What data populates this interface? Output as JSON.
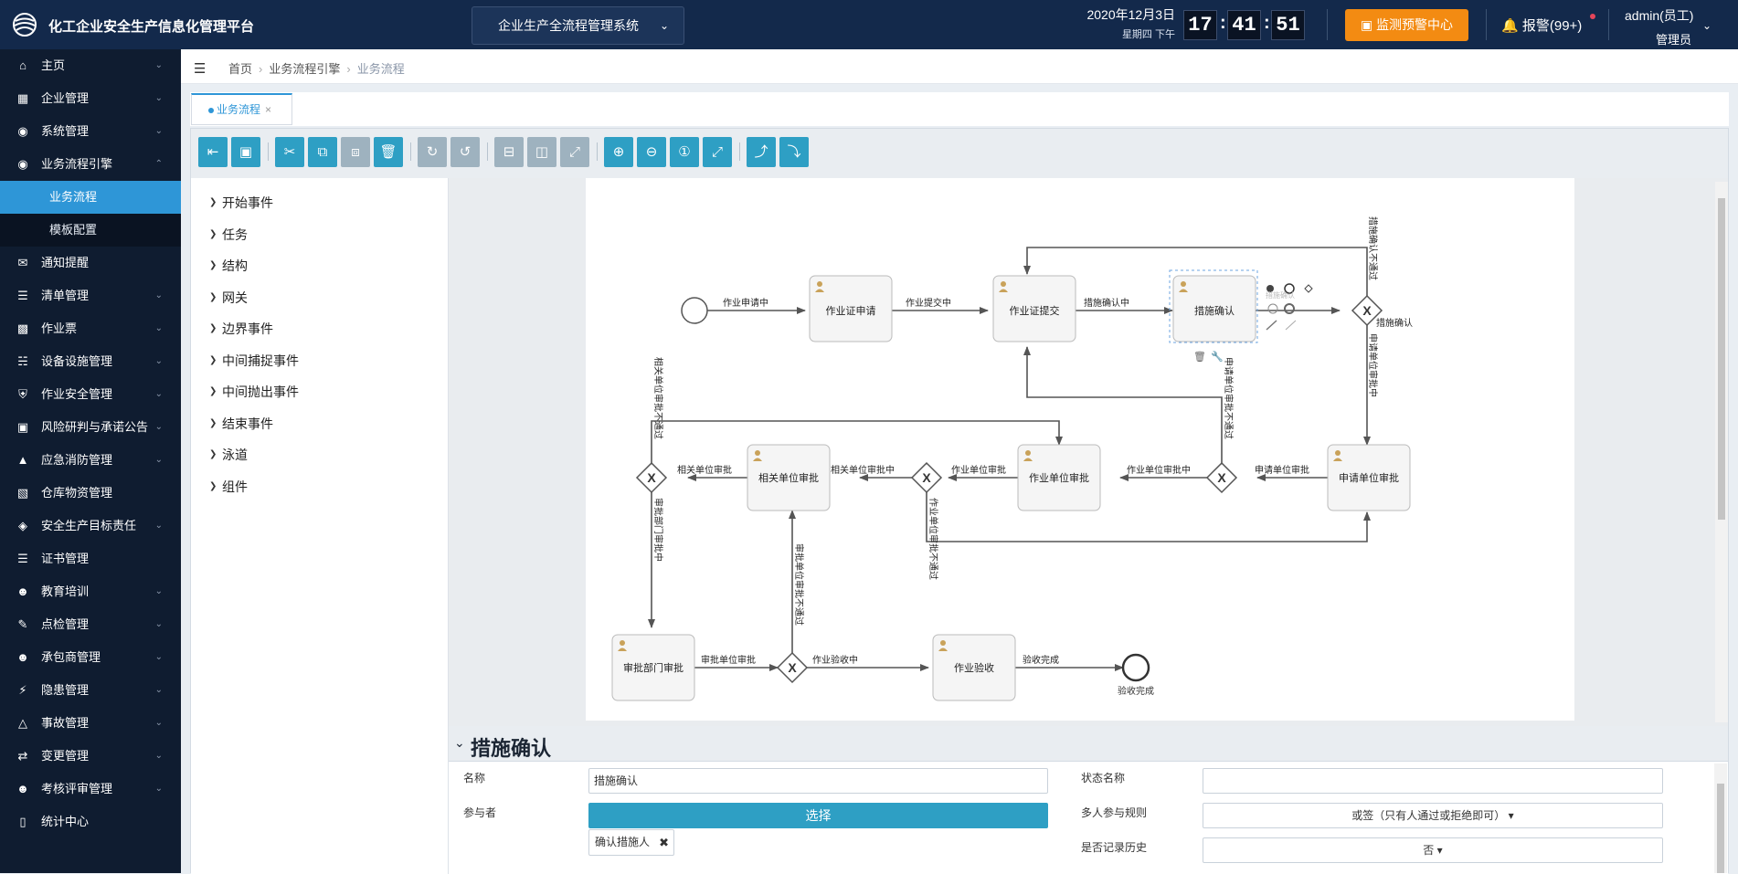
{
  "header": {
    "app_title": "化工企业安全生产信息化管理平台",
    "system_select": "企业生产全流程管理系统",
    "date": "2020年12月3日",
    "weekday": "星期四 下午",
    "clock": {
      "h": "17",
      "m": "41",
      "s": "51"
    },
    "monitor_button": "监测预警中心",
    "alarm": "报警(99+)",
    "user_name": "admin(员工)",
    "user_role": "管理员"
  },
  "sidebar": {
    "items": [
      {
        "label": "主页"
      },
      {
        "label": "企业管理"
      },
      {
        "label": "系统管理"
      },
      {
        "label": "业务流程引擎"
      },
      {
        "label": "通知提醒"
      },
      {
        "label": "清单管理"
      },
      {
        "label": "作业票"
      },
      {
        "label": "设备设施管理"
      },
      {
        "label": "作业安全管理"
      },
      {
        "label": "风险研判与承诺公告"
      },
      {
        "label": "应急消防管理"
      },
      {
        "label": "仓库物资管理"
      },
      {
        "label": "安全生产目标责任"
      },
      {
        "label": "证书管理"
      },
      {
        "label": "教育培训"
      },
      {
        "label": "点检管理"
      },
      {
        "label": "承包商管理"
      },
      {
        "label": "隐患管理"
      },
      {
        "label": "事故管理"
      },
      {
        "label": "变更管理"
      },
      {
        "label": "考核评审管理"
      },
      {
        "label": "统计中心"
      }
    ],
    "sub_items": [
      {
        "label": "业务流程"
      },
      {
        "label": "模板配置"
      }
    ]
  },
  "breadcrumb": {
    "home": "首页",
    "parent": "业务流程引擎",
    "current": "业务流程"
  },
  "tab": {
    "label": "业务流程"
  },
  "palette": {
    "items": [
      {
        "label": "开始事件"
      },
      {
        "label": "任务"
      },
      {
        "label": "结构"
      },
      {
        "label": "网关"
      },
      {
        "label": "边界事件"
      },
      {
        "label": "中间捕捉事件"
      },
      {
        "label": "中间抛出事件"
      },
      {
        "label": "结束事件"
      },
      {
        "label": "泳道"
      },
      {
        "label": "组件"
      }
    ]
  },
  "diagram": {
    "tasks": {
      "apply": "作业证申请",
      "submit": "作业证提交",
      "confirm": "措施确认",
      "apply_unit": "申请单位审批",
      "work_unit": "作业单位审批",
      "related_unit": "相关单位审批",
      "dept": "审批部门审批",
      "accept": "作业验收"
    },
    "flows": {
      "f1": "作业申请中",
      "f2": "作业提交中",
      "f3": "措施确认中",
      "f4": "措施确认",
      "f5": "措施确认不通过",
      "f6": "申请单位审批中",
      "f7": "申请单位审批",
      "f8": "作业单位审批中",
      "f9": "申请单位审批不通过",
      "f10": "作业单位审批",
      "f11": "相关单位审批中",
      "f12": "作业单位审批不通过",
      "f13": "相关单位审批",
      "f14": "相关单位审批不通过",
      "f15": "审批部门审批中",
      "f16": "审批单位审批",
      "f17": "审批单位审批不通过",
      "f18": "作业验收中",
      "f19": "验收完成"
    },
    "end_label": "验收完成",
    "ghost_label": "措施确认"
  },
  "props": {
    "title": "措施确认",
    "name_label": "名称",
    "name_value": "措施确认",
    "state_label": "状态名称",
    "state_value": "",
    "participant_label": "参与者",
    "choose_button": "选择",
    "participant_tag": "确认措施人",
    "multi_rule_label": "多人参与规则",
    "multi_rule_value": "或签（只有人通过或拒绝即可）",
    "history_label": "是否记录历史",
    "history_value": "否"
  }
}
